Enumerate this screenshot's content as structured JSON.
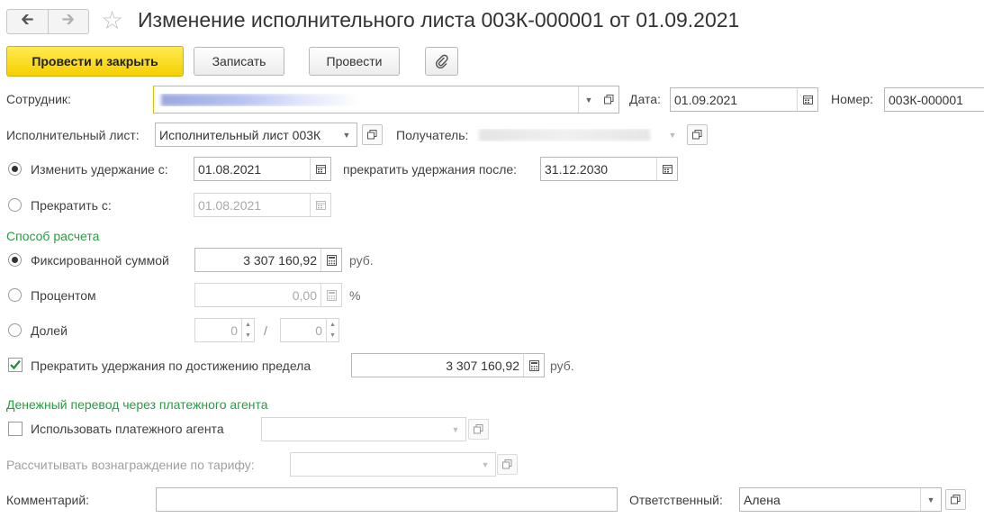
{
  "window": {
    "title": "Изменение исполнительного листа 003К-000001 от 01.09.2021"
  },
  "toolbar": {
    "post_close_label": "Провести и закрыть",
    "save_label": "Записать",
    "post_label": "Провести"
  },
  "header": {
    "employee_label": "Сотрудник:",
    "date_label": "Дата:",
    "date_value": "01.09.2021",
    "number_label": "Номер:",
    "number_value": "003К-000001"
  },
  "writ": {
    "label": "Исполнительный лист:",
    "value": "Исполнительный лист 003К",
    "recipient_label": "Получатель:"
  },
  "change": {
    "radio_label": "Изменить удержание с:",
    "from_date": "01.08.2021",
    "stop_after_label": "прекратить удержания после:",
    "stop_after_date": "31.12.2030"
  },
  "stop": {
    "radio_label": "Прекратить с:",
    "date": "01.08.2021"
  },
  "calc": {
    "section_title": "Способ расчета",
    "fixed_label": "Фиксированной суммой",
    "fixed_value": "3 307 160,92",
    "fixed_unit": "руб.",
    "percent_label": "Процентом",
    "percent_value": "0,00",
    "percent_unit": "%",
    "share_label": "Долей",
    "share_num": "0",
    "share_sep": "/",
    "share_den": "0"
  },
  "limit": {
    "checkbox_label": "Прекратить удержания по достижению предела",
    "value": "3 307 160,92",
    "unit": "руб."
  },
  "agent": {
    "section_title": "Денежный перевод через платежного агента",
    "use_label": "Использовать платежного агента",
    "tariff_label": "Рассчитывать вознаграждение по тарифу:"
  },
  "footer": {
    "comment_label": "Комментарий:",
    "responsible_label": "Ответственный:",
    "responsible_value": "Алена"
  },
  "colors": {
    "accent_yellow": "#f5cf00",
    "section_green": "#2a9b43"
  }
}
